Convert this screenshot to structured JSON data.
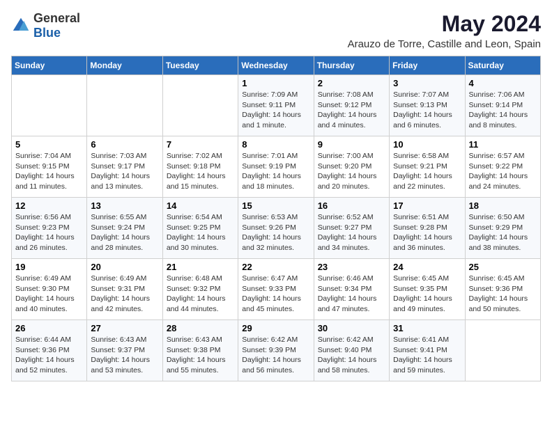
{
  "logo": {
    "general": "General",
    "blue": "Blue"
  },
  "title": "May 2024",
  "subtitle": "Arauzo de Torre, Castille and Leon, Spain",
  "days_header": [
    "Sunday",
    "Monday",
    "Tuesday",
    "Wednesday",
    "Thursday",
    "Friday",
    "Saturday"
  ],
  "weeks": [
    [
      {
        "day": "",
        "info": ""
      },
      {
        "day": "",
        "info": ""
      },
      {
        "day": "",
        "info": ""
      },
      {
        "day": "1",
        "info": "Sunrise: 7:09 AM\nSunset: 9:11 PM\nDaylight: 14 hours\nand 1 minute."
      },
      {
        "day": "2",
        "info": "Sunrise: 7:08 AM\nSunset: 9:12 PM\nDaylight: 14 hours\nand 4 minutes."
      },
      {
        "day": "3",
        "info": "Sunrise: 7:07 AM\nSunset: 9:13 PM\nDaylight: 14 hours\nand 6 minutes."
      },
      {
        "day": "4",
        "info": "Sunrise: 7:06 AM\nSunset: 9:14 PM\nDaylight: 14 hours\nand 8 minutes."
      }
    ],
    [
      {
        "day": "5",
        "info": "Sunrise: 7:04 AM\nSunset: 9:15 PM\nDaylight: 14 hours\nand 11 minutes."
      },
      {
        "day": "6",
        "info": "Sunrise: 7:03 AM\nSunset: 9:17 PM\nDaylight: 14 hours\nand 13 minutes."
      },
      {
        "day": "7",
        "info": "Sunrise: 7:02 AM\nSunset: 9:18 PM\nDaylight: 14 hours\nand 15 minutes."
      },
      {
        "day": "8",
        "info": "Sunrise: 7:01 AM\nSunset: 9:19 PM\nDaylight: 14 hours\nand 18 minutes."
      },
      {
        "day": "9",
        "info": "Sunrise: 7:00 AM\nSunset: 9:20 PM\nDaylight: 14 hours\nand 20 minutes."
      },
      {
        "day": "10",
        "info": "Sunrise: 6:58 AM\nSunset: 9:21 PM\nDaylight: 14 hours\nand 22 minutes."
      },
      {
        "day": "11",
        "info": "Sunrise: 6:57 AM\nSunset: 9:22 PM\nDaylight: 14 hours\nand 24 minutes."
      }
    ],
    [
      {
        "day": "12",
        "info": "Sunrise: 6:56 AM\nSunset: 9:23 PM\nDaylight: 14 hours\nand 26 minutes."
      },
      {
        "day": "13",
        "info": "Sunrise: 6:55 AM\nSunset: 9:24 PM\nDaylight: 14 hours\nand 28 minutes."
      },
      {
        "day": "14",
        "info": "Sunrise: 6:54 AM\nSunset: 9:25 PM\nDaylight: 14 hours\nand 30 minutes."
      },
      {
        "day": "15",
        "info": "Sunrise: 6:53 AM\nSunset: 9:26 PM\nDaylight: 14 hours\nand 32 minutes."
      },
      {
        "day": "16",
        "info": "Sunrise: 6:52 AM\nSunset: 9:27 PM\nDaylight: 14 hours\nand 34 minutes."
      },
      {
        "day": "17",
        "info": "Sunrise: 6:51 AM\nSunset: 9:28 PM\nDaylight: 14 hours\nand 36 minutes."
      },
      {
        "day": "18",
        "info": "Sunrise: 6:50 AM\nSunset: 9:29 PM\nDaylight: 14 hours\nand 38 minutes."
      }
    ],
    [
      {
        "day": "19",
        "info": "Sunrise: 6:49 AM\nSunset: 9:30 PM\nDaylight: 14 hours\nand 40 minutes."
      },
      {
        "day": "20",
        "info": "Sunrise: 6:49 AM\nSunset: 9:31 PM\nDaylight: 14 hours\nand 42 minutes."
      },
      {
        "day": "21",
        "info": "Sunrise: 6:48 AM\nSunset: 9:32 PM\nDaylight: 14 hours\nand 44 minutes."
      },
      {
        "day": "22",
        "info": "Sunrise: 6:47 AM\nSunset: 9:33 PM\nDaylight: 14 hours\nand 45 minutes."
      },
      {
        "day": "23",
        "info": "Sunrise: 6:46 AM\nSunset: 9:34 PM\nDaylight: 14 hours\nand 47 minutes."
      },
      {
        "day": "24",
        "info": "Sunrise: 6:45 AM\nSunset: 9:35 PM\nDaylight: 14 hours\nand 49 minutes."
      },
      {
        "day": "25",
        "info": "Sunrise: 6:45 AM\nSunset: 9:36 PM\nDaylight: 14 hours\nand 50 minutes."
      }
    ],
    [
      {
        "day": "26",
        "info": "Sunrise: 6:44 AM\nSunset: 9:36 PM\nDaylight: 14 hours\nand 52 minutes."
      },
      {
        "day": "27",
        "info": "Sunrise: 6:43 AM\nSunset: 9:37 PM\nDaylight: 14 hours\nand 53 minutes."
      },
      {
        "day": "28",
        "info": "Sunrise: 6:43 AM\nSunset: 9:38 PM\nDaylight: 14 hours\nand 55 minutes."
      },
      {
        "day": "29",
        "info": "Sunrise: 6:42 AM\nSunset: 9:39 PM\nDaylight: 14 hours\nand 56 minutes."
      },
      {
        "day": "30",
        "info": "Sunrise: 6:42 AM\nSunset: 9:40 PM\nDaylight: 14 hours\nand 58 minutes."
      },
      {
        "day": "31",
        "info": "Sunrise: 6:41 AM\nSunset: 9:41 PM\nDaylight: 14 hours\nand 59 minutes."
      },
      {
        "day": "",
        "info": ""
      }
    ]
  ]
}
